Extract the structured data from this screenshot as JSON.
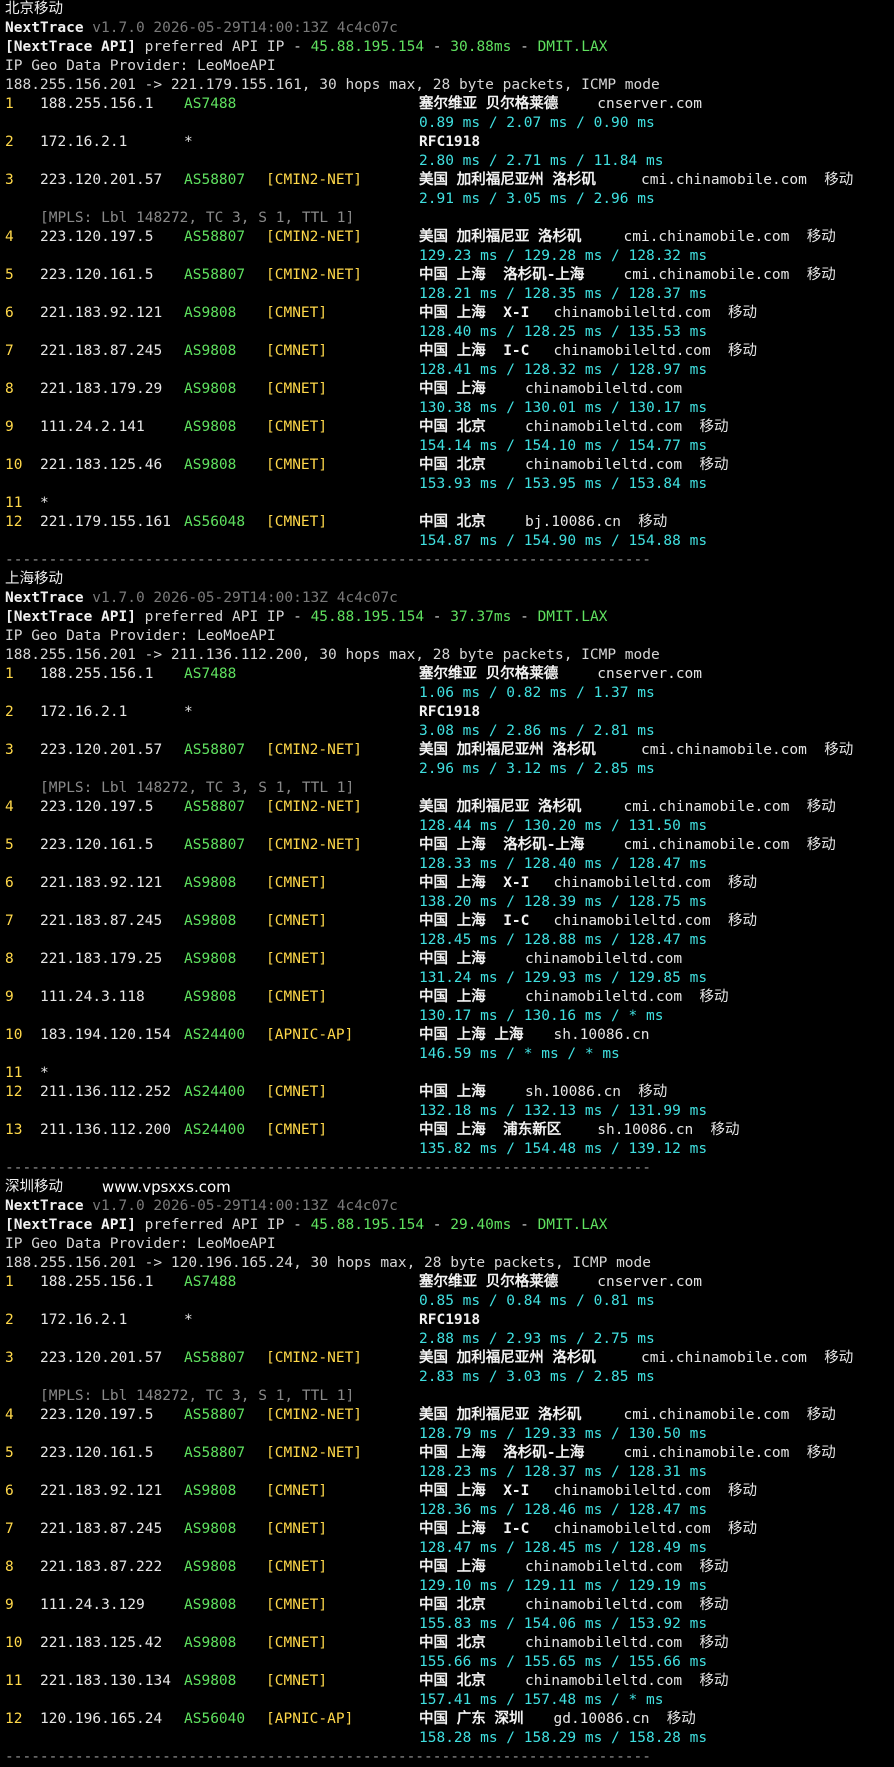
{
  "sections": [
    {
      "title": "北京移动",
      "version": "v1.7.0 2026-05-29T14:00:13Z 4c4c07c",
      "api_ip": "45.88.195.154",
      "api_ms": "30.88ms",
      "api_site": "DMIT.LAX",
      "provider": "IP Geo Data Provider: LeoMoeAPI",
      "route": "188.255.156.201 -> 221.179.155.161, 30 hops max, 28 byte packets, ICMP mode",
      "hops": [
        {
          "n": "1",
          "ip": "188.255.156.1",
          "asn": "AS7488",
          "tag": "",
          "geo": "塞尔维亚 贝尔格莱德",
          "host": "cnserver.com",
          "isp": "",
          "lat": "0.89 ms / 2.07 ms / 0.90 ms"
        },
        {
          "n": "2",
          "ip": "172.16.2.1",
          "asn": "*",
          "tag": "",
          "geo": "RFC1918",
          "host": "",
          "isp": "",
          "lat": "2.80 ms / 2.71 ms / 11.84 ms"
        },
        {
          "n": "3",
          "ip": "223.120.201.57",
          "asn": "AS58807",
          "tag": "[CMIN2-NET]",
          "geo": "美国 加利福尼亚州 洛杉矶",
          "host": "cmi.chinamobile.com",
          "isp": "移动",
          "lat": "2.91 ms / 3.05 ms / 2.96 ms"
        },
        {
          "n": "4",
          "ip": "223.120.197.5",
          "asn": "AS58807",
          "tag": "[CMIN2-NET]",
          "geo": "美国 加利福尼亚 洛杉矶",
          "host": "cmi.chinamobile.com",
          "isp": "移动",
          "lat": "129.23 ms / 129.28 ms / 128.32 ms",
          "mpls": "[MPLS: Lbl 148272, TC 3, S 1, TTL 1]"
        },
        {
          "n": "5",
          "ip": "223.120.161.5",
          "asn": "AS58807",
          "tag": "[CMIN2-NET]",
          "geo": "中国 上海  洛杉矶-上海",
          "host": "cmi.chinamobile.com",
          "isp": "移动",
          "lat": "128.21 ms / 128.35 ms / 128.37 ms"
        },
        {
          "n": "6",
          "ip": "221.183.92.121",
          "asn": "AS9808",
          "tag": "[CMNET]",
          "geo": "中国 上海  X-I",
          "host": "chinamobileltd.com",
          "isp": "移动",
          "lat": "128.40 ms / 128.25 ms / 135.53 ms"
        },
        {
          "n": "7",
          "ip": "221.183.87.245",
          "asn": "AS9808",
          "tag": "[CMNET]",
          "geo": "中国 上海  I-C",
          "host": "chinamobileltd.com",
          "isp": "移动",
          "lat": "128.41 ms / 128.32 ms / 128.97 ms"
        },
        {
          "n": "8",
          "ip": "221.183.179.29",
          "asn": "AS9808",
          "tag": "[CMNET]",
          "geo": "中国 上海",
          "host": "chinamobileltd.com",
          "isp": "",
          "lat": "130.38 ms / 130.01 ms / 130.17 ms"
        },
        {
          "n": "9",
          "ip": "111.24.2.141",
          "asn": "AS9808",
          "tag": "[CMNET]",
          "geo": "中国 北京",
          "host": "chinamobileltd.com",
          "isp": "移动",
          "lat": "154.14 ms / 154.10 ms / 154.77 ms"
        },
        {
          "n": "10",
          "ip": "221.183.125.46",
          "asn": "AS9808",
          "tag": "[CMNET]",
          "geo": "中国 北京",
          "host": "chinamobileltd.com",
          "isp": "移动",
          "lat": "153.93 ms / 153.95 ms / 153.84 ms"
        },
        {
          "n": "11",
          "ip": "*",
          "asn": "",
          "tag": "",
          "geo": "",
          "host": "",
          "isp": "",
          "lat": ""
        },
        {
          "n": "12",
          "ip": "221.179.155.161",
          "asn": "AS56048",
          "tag": "[CMNET]",
          "geo": "中国 北京",
          "host": "bj.10086.cn",
          "isp": "移动",
          "lat": "154.87 ms / 154.90 ms / 154.88 ms"
        }
      ]
    },
    {
      "title": "上海移动",
      "version": "v1.7.0 2026-05-29T14:00:13Z 4c4c07c",
      "api_ip": "45.88.195.154",
      "api_ms": "37.37ms",
      "api_site": "DMIT.LAX",
      "provider": "IP Geo Data Provider: LeoMoeAPI",
      "route": "188.255.156.201 -> 211.136.112.200, 30 hops max, 28 byte packets, ICMP mode",
      "hops": [
        {
          "n": "1",
          "ip": "188.255.156.1",
          "asn": "AS7488",
          "tag": "",
          "geo": "塞尔维亚 贝尔格莱德",
          "host": "cnserver.com",
          "isp": "",
          "lat": "1.06 ms / 0.82 ms / 1.37 ms"
        },
        {
          "n": "2",
          "ip": "172.16.2.1",
          "asn": "*",
          "tag": "",
          "geo": "RFC1918",
          "host": "",
          "isp": "",
          "lat": "3.08 ms / 2.86 ms / 2.81 ms"
        },
        {
          "n": "3",
          "ip": "223.120.201.57",
          "asn": "AS58807",
          "tag": "[CMIN2-NET]",
          "geo": "美国 加利福尼亚州 洛杉矶",
          "host": "cmi.chinamobile.com",
          "isp": "移动",
          "lat": "2.96 ms / 3.12 ms / 2.85 ms"
        },
        {
          "n": "4",
          "ip": "223.120.197.5",
          "asn": "AS58807",
          "tag": "[CMIN2-NET]",
          "geo": "美国 加利福尼亚 洛杉矶",
          "host": "cmi.chinamobile.com",
          "isp": "移动",
          "lat": "128.44 ms / 130.20 ms / 131.50 ms",
          "mpls": "[MPLS: Lbl 148272, TC 3, S 1, TTL 1]"
        },
        {
          "n": "5",
          "ip": "223.120.161.5",
          "asn": "AS58807",
          "tag": "[CMIN2-NET]",
          "geo": "中国 上海  洛杉矶-上海",
          "host": "cmi.chinamobile.com",
          "isp": "移动",
          "lat": "128.33 ms / 128.40 ms / 128.47 ms"
        },
        {
          "n": "6",
          "ip": "221.183.92.121",
          "asn": "AS9808",
          "tag": "[CMNET]",
          "geo": "中国 上海  X-I",
          "host": "chinamobileltd.com",
          "isp": "移动",
          "lat": "138.20 ms / 128.39 ms / 128.75 ms"
        },
        {
          "n": "7",
          "ip": "221.183.87.245",
          "asn": "AS9808",
          "tag": "[CMNET]",
          "geo": "中国 上海  I-C",
          "host": "chinamobileltd.com",
          "isp": "移动",
          "lat": "128.45 ms / 128.88 ms / 128.47 ms"
        },
        {
          "n": "8",
          "ip": "221.183.179.25",
          "asn": "AS9808",
          "tag": "[CMNET]",
          "geo": "中国 上海",
          "host": "chinamobileltd.com",
          "isp": "",
          "lat": "131.24 ms / 129.93 ms / 129.85 ms"
        },
        {
          "n": "9",
          "ip": "111.24.3.118",
          "asn": "AS9808",
          "tag": "[CMNET]",
          "geo": "中国 上海",
          "host": "chinamobileltd.com",
          "isp": "移动",
          "lat": "130.17 ms / 130.16 ms / * ms"
        },
        {
          "n": "10",
          "ip": "183.194.120.154",
          "asn": "AS24400",
          "tag": "[APNIC-AP]",
          "geo": "中国 上海 上海",
          "host": "sh.10086.cn",
          "isp": "",
          "lat": "146.59 ms / * ms / * ms"
        },
        {
          "n": "11",
          "ip": "*",
          "asn": "",
          "tag": "",
          "geo": "",
          "host": "",
          "isp": "",
          "lat": ""
        },
        {
          "n": "12",
          "ip": "211.136.112.252",
          "asn": "AS24400",
          "tag": "[CMNET]",
          "geo": "中国 上海",
          "host": "sh.10086.cn",
          "isp": "移动",
          "lat": "132.18 ms / 132.13 ms / 131.99 ms"
        },
        {
          "n": "13",
          "ip": "211.136.112.200",
          "asn": "AS24400",
          "tag": "[CMNET]",
          "geo": "中国 上海  浦东新区",
          "host": "sh.10086.cn",
          "isp": "移动",
          "lat": "135.82 ms / 154.48 ms / 139.12 ms"
        }
      ]
    },
    {
      "title": "深圳移动",
      "watermark": "www.vpsxxs.com",
      "version": "v1.7.0 2026-05-29T14:00:13Z 4c4c07c",
      "api_ip": "45.88.195.154",
      "api_ms": "29.40ms",
      "api_site": "DMIT.LAX",
      "provider": "IP Geo Data Provider: LeoMoeAPI",
      "route": "188.255.156.201 -> 120.196.165.24, 30 hops max, 28 byte packets, ICMP mode",
      "hops": [
        {
          "n": "1",
          "ip": "188.255.156.1",
          "asn": "AS7488",
          "tag": "",
          "geo": "塞尔维亚 贝尔格莱德",
          "host": "cnserver.com",
          "isp": "",
          "lat": "0.85 ms / 0.84 ms / 0.81 ms"
        },
        {
          "n": "2",
          "ip": "172.16.2.1",
          "asn": "*",
          "tag": "",
          "geo": "RFC1918",
          "host": "",
          "isp": "",
          "lat": "2.88 ms / 2.93 ms / 2.75 ms"
        },
        {
          "n": "3",
          "ip": "223.120.201.57",
          "asn": "AS58807",
          "tag": "[CMIN2-NET]",
          "geo": "美国 加利福尼亚州 洛杉矶",
          "host": "cmi.chinamobile.com",
          "isp": "移动",
          "lat": "2.83 ms / 3.03 ms / 2.85 ms"
        },
        {
          "n": "4",
          "ip": "223.120.197.5",
          "asn": "AS58807",
          "tag": "[CMIN2-NET]",
          "geo": "美国 加利福尼亚 洛杉矶",
          "host": "cmi.chinamobile.com",
          "isp": "移动",
          "lat": "128.79 ms / 129.33 ms / 130.50 ms",
          "mpls": "[MPLS: Lbl 148272, TC 3, S 1, TTL 1]"
        },
        {
          "n": "5",
          "ip": "223.120.161.5",
          "asn": "AS58807",
          "tag": "[CMIN2-NET]",
          "geo": "中国 上海  洛杉矶-上海",
          "host": "cmi.chinamobile.com",
          "isp": "移动",
          "lat": "128.23 ms / 128.37 ms / 128.31 ms"
        },
        {
          "n": "6",
          "ip": "221.183.92.121",
          "asn": "AS9808",
          "tag": "[CMNET]",
          "geo": "中国 上海  X-I",
          "host": "chinamobileltd.com",
          "isp": "移动",
          "lat": "128.36 ms / 128.46 ms / 128.47 ms"
        },
        {
          "n": "7",
          "ip": "221.183.87.245",
          "asn": "AS9808",
          "tag": "[CMNET]",
          "geo": "中国 上海  I-C",
          "host": "chinamobileltd.com",
          "isp": "移动",
          "lat": "128.47 ms / 128.45 ms / 128.49 ms"
        },
        {
          "n": "8",
          "ip": "221.183.87.222",
          "asn": "AS9808",
          "tag": "[CMNET]",
          "geo": "中国 上海",
          "host": "chinamobileltd.com",
          "isp": "移动",
          "lat": "129.10 ms / 129.11 ms / 129.19 ms"
        },
        {
          "n": "9",
          "ip": "111.24.3.129",
          "asn": "AS9808",
          "tag": "[CMNET]",
          "geo": "中国 北京",
          "host": "chinamobileltd.com",
          "isp": "移动",
          "lat": "155.83 ms / 154.06 ms / 153.92 ms"
        },
        {
          "n": "10",
          "ip": "221.183.125.42",
          "asn": "AS9808",
          "tag": "[CMNET]",
          "geo": "中国 北京",
          "host": "chinamobileltd.com",
          "isp": "移动",
          "lat": "155.66 ms / 155.65 ms / 155.66 ms"
        },
        {
          "n": "11",
          "ip": "221.183.130.134",
          "asn": "AS9808",
          "tag": "[CMNET]",
          "geo": "中国 北京",
          "host": "chinamobileltd.com",
          "isp": "移动",
          "lat": "157.41 ms / 157.48 ms / * ms"
        },
        {
          "n": "12",
          "ip": "120.196.165.24",
          "asn": "AS56040",
          "tag": "[APNIC-AP]",
          "geo": "中国 广东 深圳",
          "host": "gd.10086.cn",
          "isp": "移动",
          "lat": "158.28 ms / 158.29 ms / 158.28 ms"
        }
      ]
    }
  ],
  "labels": {
    "nexttrace": "NextTrace",
    "api_prefix": "[NextTrace API]",
    "api_mid": " preferred API IP - ",
    "dash": " - "
  },
  "separator": "--------------------------------------------------------------------------",
  "colors": {
    "background": "#000000",
    "hop": "#ffd84a",
    "asn": "#5fe05f",
    "tag": "#ffd84a",
    "latency": "#40e0e0",
    "mpls": "#8a8a8a"
  }
}
